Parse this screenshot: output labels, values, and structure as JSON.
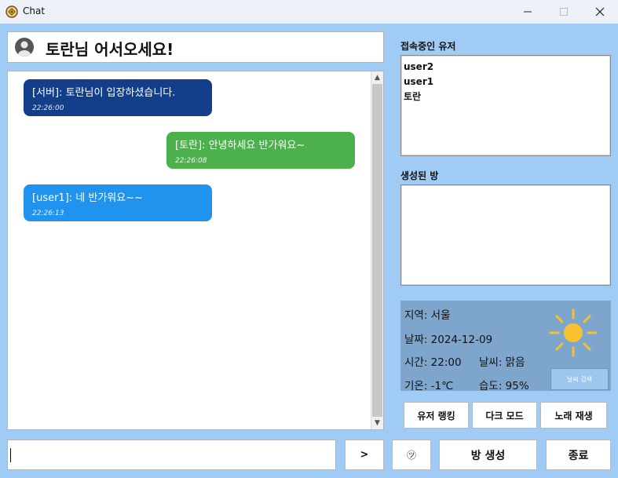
{
  "window": {
    "title": "Chat"
  },
  "header": {
    "welcome": "토란님 어서오세요!"
  },
  "chat": {
    "messages": [
      {
        "text": "[서버]: 토란님이 입장하셨습니다.",
        "time": "22:26:00",
        "color": "#133f8a"
      },
      {
        "text": "[토란]: 안녕하세요 반가워요~",
        "time": "22:26:08",
        "color": "#4cb04d"
      },
      {
        "text": "[user1]: 네 반가워요~~",
        "time": "22:26:13",
        "color": "#2093ee"
      }
    ]
  },
  "users": {
    "label": "접속중인 유저",
    "items": [
      "user2",
      "user1",
      "토란"
    ]
  },
  "rooms": {
    "label": "생성된 방"
  },
  "weather": {
    "region": "지역: 서울",
    "date": "날짜: 2024-12-09",
    "time": "시간: 22:00",
    "condition": "날씨: 맑음",
    "temperature": "기온: -1℃",
    "humidity": "습도: 95%",
    "search_button": "날씨 검색",
    "icon": "sun-icon"
  },
  "buttons": {
    "ranking": "유저 랭킹",
    "dark_mode": "다크 모드",
    "music": "노래 재생",
    "send": ">",
    "emoji": "㋡",
    "create_room": "방 생성",
    "exit": "종료"
  },
  "input": {
    "value": ""
  },
  "colors": {
    "background": "#9fcbf5",
    "weather_panel": "#7ea6cc",
    "sun": "#f7c232"
  }
}
